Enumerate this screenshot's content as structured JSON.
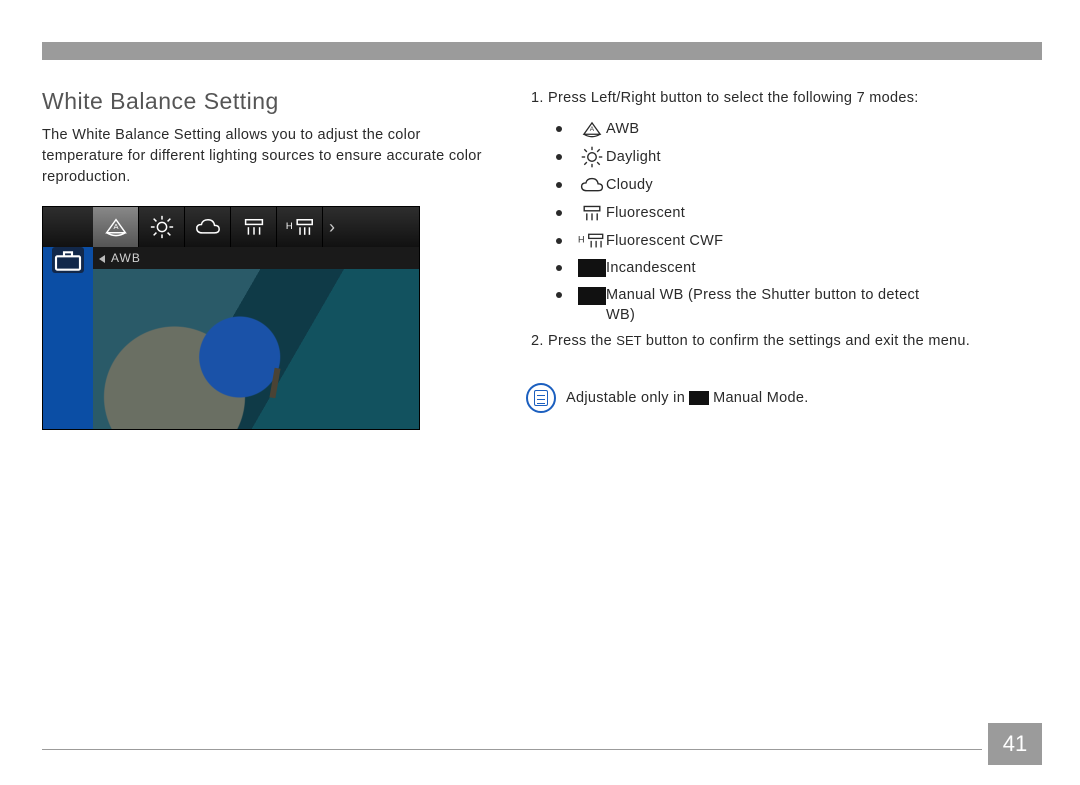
{
  "page_number": "41",
  "heading": "White Balance Setting",
  "description": "The White Balance Setting allows you to adjust the color temperature for different lighting sources to ensure accurate color reproduction.",
  "lcd": {
    "selected_label": "AWB",
    "strip_icons": [
      "awb",
      "daylight",
      "cloudy",
      "fluorescent",
      "fluorescent-cwf"
    ]
  },
  "step1_intro": "Press Left/Right button to select the following 7 modes:",
  "modes": [
    {
      "icon": "awb",
      "label": "AWB"
    },
    {
      "icon": "daylight",
      "label": "Daylight"
    },
    {
      "icon": "cloudy",
      "label": "Cloudy"
    },
    {
      "icon": "fluorescent",
      "label": "Fluorescent"
    },
    {
      "icon": "fluorescent-cwf",
      "label": "Fluorescent CWF"
    },
    {
      "icon": "incandescent",
      "label": "Incandescent"
    },
    {
      "icon": "manual-wb",
      "label": "Manual WB (Press the Shutter button to detect WB)"
    }
  ],
  "step2_pre": "Press the ",
  "step2_button": "SET",
  "step2_post": " button to confirm the settings and exit the menu.",
  "note_pre": "Adjustable only in ",
  "note_post": " Manual Mode."
}
